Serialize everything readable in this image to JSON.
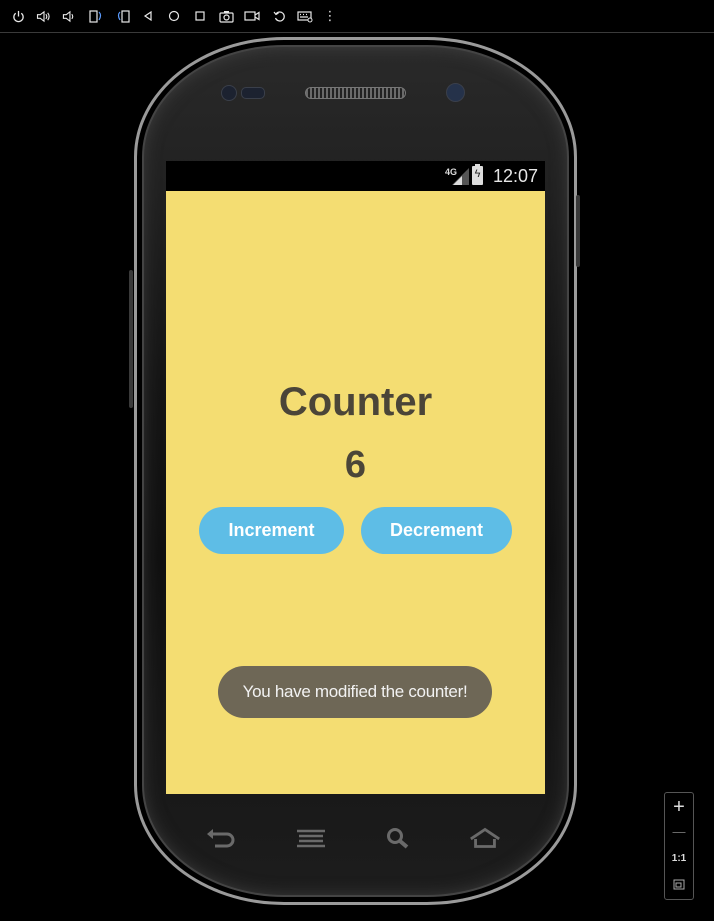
{
  "toolbar": {
    "icons": [
      "power-icon",
      "volume-up-icon",
      "volume-down-icon",
      "rotate-left-icon",
      "rotate-right-icon",
      "back-icon",
      "home-icon",
      "overview-icon",
      "camera-icon",
      "video-icon",
      "replay-icon",
      "keyboard-icon",
      "more-icon"
    ]
  },
  "statusbar": {
    "network": "4G",
    "clock": "12:07"
  },
  "app": {
    "title": "Counter",
    "count": "6",
    "increment_label": "Increment",
    "decrement_label": "Decrement",
    "toast": "You have modified the counter!"
  },
  "zoom": {
    "plus": "+",
    "minus": "—",
    "one_to_one": "1:1"
  },
  "colors": {
    "screen_bg": "#f4dd72",
    "button_bg": "#5ebde6",
    "toast_bg": "#6e6756",
    "text_dark": "#4b4538"
  }
}
